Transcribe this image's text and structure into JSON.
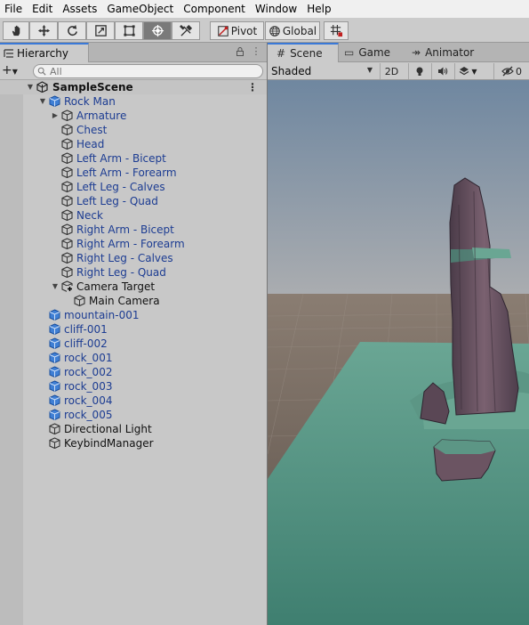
{
  "menu": [
    "File",
    "Edit",
    "Assets",
    "GameObject",
    "Component",
    "Window",
    "Help"
  ],
  "toolbar": {
    "tools": [
      "hand-tool",
      "move-tool",
      "rotate-tool",
      "scale-tool",
      "rect-tool",
      "transform-tool",
      "custom-tool"
    ],
    "active_tool": "transform-tool",
    "pivot_label": "Pivot",
    "global_label": "Global",
    "snap_icon": "grid-snap-icon"
  },
  "hierarchy": {
    "tab_label": "Hierarchy",
    "search_placeholder": "All",
    "scene": "SampleScene",
    "items": [
      {
        "label": "Rock Man",
        "indent": 1,
        "expanded": true,
        "prefab": true
      },
      {
        "label": "Armature",
        "indent": 2,
        "collapsed": true,
        "prefab": false
      },
      {
        "label": "Chest",
        "indent": 2,
        "prefab": false
      },
      {
        "label": "Head",
        "indent": 2,
        "prefab": false
      },
      {
        "label": "Left Arm - Bicept",
        "indent": 2,
        "prefab": false
      },
      {
        "label": "Left Arm - Forearm",
        "indent": 2,
        "prefab": false
      },
      {
        "label": "Left Leg - Calves",
        "indent": 2,
        "prefab": false
      },
      {
        "label": "Left Leg - Quad",
        "indent": 2,
        "prefab": false
      },
      {
        "label": "Neck",
        "indent": 2,
        "prefab": false
      },
      {
        "label": "Right Arm - Bicept",
        "indent": 2,
        "prefab": false
      },
      {
        "label": "Right Arm - Forearm",
        "indent": 2,
        "prefab": false
      },
      {
        "label": "Right Leg - Calves",
        "indent": 2,
        "prefab": false
      },
      {
        "label": "Right Leg - Quad",
        "indent": 2,
        "prefab": false
      },
      {
        "label": "Camera Target",
        "indent": 2,
        "expanded": true,
        "prefab": false,
        "added": true
      },
      {
        "label": "Main Camera",
        "indent": 3,
        "prefab": false
      },
      {
        "label": "mountain-001",
        "indent": 1,
        "prefab": true
      },
      {
        "label": "cliff-001",
        "indent": 1,
        "prefab": true
      },
      {
        "label": "cliff-002",
        "indent": 1,
        "prefab": true
      },
      {
        "label": "rock_001",
        "indent": 1,
        "prefab": true
      },
      {
        "label": "rock_002",
        "indent": 1,
        "prefab": true
      },
      {
        "label": "rock_003",
        "indent": 1,
        "prefab": true
      },
      {
        "label": "rock_004",
        "indent": 1,
        "prefab": true
      },
      {
        "label": "rock_005",
        "indent": 1,
        "prefab": true
      },
      {
        "label": "Directional Light",
        "indent": 1,
        "prefab": false
      },
      {
        "label": "KeybindManager",
        "indent": 1,
        "prefab": false
      }
    ]
  },
  "scene_view": {
    "tabs": [
      {
        "label": "Scene",
        "icon": "#"
      },
      {
        "label": "Game",
        "icon": "▭"
      },
      {
        "label": "Animator",
        "icon": "↠"
      }
    ],
    "shading_mode": "Shaded",
    "mode_2d": "2D",
    "hidden_count": "0"
  },
  "colors": {
    "prefab_text": "#1c3c92",
    "selected_tab_accent": "#3a79d8",
    "sky": "#8fa2b4",
    "ground": "#766b62",
    "water": "#5e9b8a",
    "rock": "#6b5462"
  }
}
